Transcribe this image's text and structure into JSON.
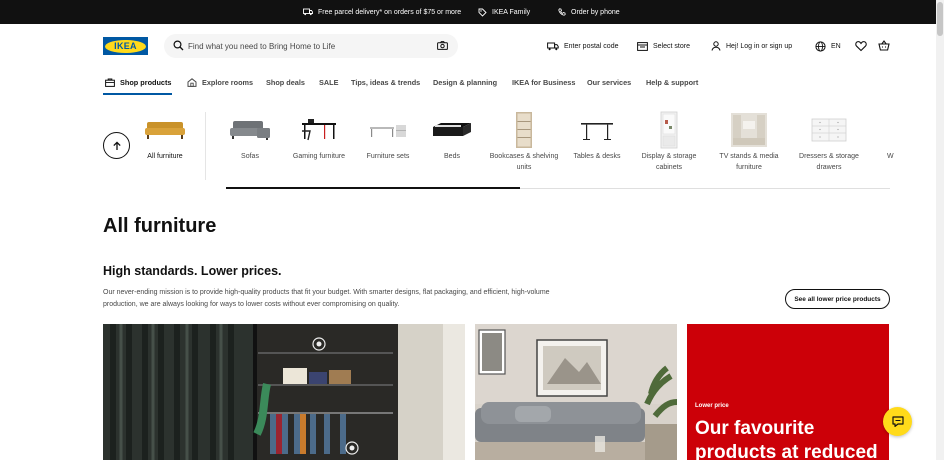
{
  "topbar": {
    "delivery": "Free parcel delivery* on orders of $75 or more",
    "family": "IKEA Family",
    "phone": "Order by phone"
  },
  "header": {
    "logo_text": "IKEA",
    "search_placeholder": "Find what you need to Bring Home to Life",
    "postal": "Enter postal code",
    "store": "Select store",
    "login": "Hej! Log in or sign up",
    "language": "EN"
  },
  "nav": {
    "tabs": [
      {
        "label": "Shop products"
      },
      {
        "label": "Explore rooms"
      },
      {
        "label": "Shop deals"
      },
      {
        "label": "SALE"
      },
      {
        "label": "Tips, ideas & trends"
      },
      {
        "label": "Design & planning"
      },
      {
        "label": "IKEA for Business"
      },
      {
        "label": "Our services"
      },
      {
        "label": "Help & support"
      }
    ]
  },
  "categories": [
    {
      "label": "All furniture"
    },
    {
      "label": "Sofas"
    },
    {
      "label": "Gaming furniture"
    },
    {
      "label": "Furniture sets"
    },
    {
      "label": "Beds"
    },
    {
      "label": "Bookcases & shelving units"
    },
    {
      "label": "Tables & desks"
    },
    {
      "label": "Display & storage cabinets"
    },
    {
      "label": "TV stands & media furniture"
    },
    {
      "label": "Dressers & storage drawers"
    },
    {
      "label": "W"
    }
  ],
  "main": {
    "title": "All furniture",
    "section_title": "High standards. Lower prices.",
    "section_text": "Our never-ending mission is to provide high-quality products that fit your budget. With smarter designs, flat packaging, and efficient, high-volume production, we are always looking for ways to lower costs without ever compromising on quality.",
    "cta": "See all lower price products",
    "promo_kicker": "Lower price",
    "promo_headline": "Our favourite products at reduced"
  },
  "colors": {
    "brand_blue": "#0058a3",
    "brand_yellow": "#ffda1a",
    "promo_red": "#cc0008"
  }
}
